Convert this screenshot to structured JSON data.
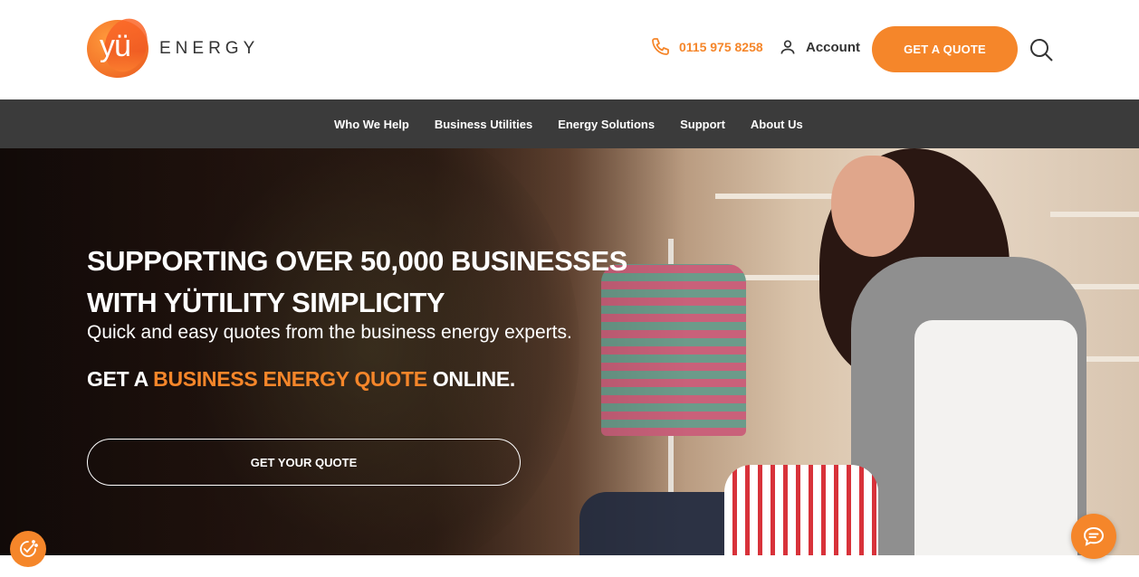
{
  "header": {
    "logo_mark_text": "yü",
    "logo_word": "ENERGY",
    "phone_number": "0115 975 8258",
    "account_label": "Account",
    "quote_button_label": "GET A QUOTE"
  },
  "nav": {
    "items": [
      {
        "label": "Who We Help"
      },
      {
        "label": "Business Utilities"
      },
      {
        "label": "Energy Solutions"
      },
      {
        "label": "Support"
      },
      {
        "label": "About Us"
      }
    ]
  },
  "hero": {
    "headline_line1": "SUPPORTING OVER 50,000 BUSINESSES",
    "headline_line2": "WITH YÜTILITY SIMPLICITY",
    "subheadline": "Quick and easy quotes from the business energy experts.",
    "quote_prefix": "GET A ",
    "quote_highlight": "BUSINESS ENERGY QUOTE",
    "quote_suffix": " ONLINE.",
    "cta_label": "GET YOUR QUOTE"
  },
  "icons": {
    "phone": "phone-icon",
    "account": "user-icon",
    "search": "search-icon",
    "cookie": "cookie-consent-icon",
    "chat": "chat-icon"
  },
  "colors": {
    "accent": "#f5862a",
    "nav_bg": "#3b3b3b",
    "text_dark": "#333333"
  }
}
